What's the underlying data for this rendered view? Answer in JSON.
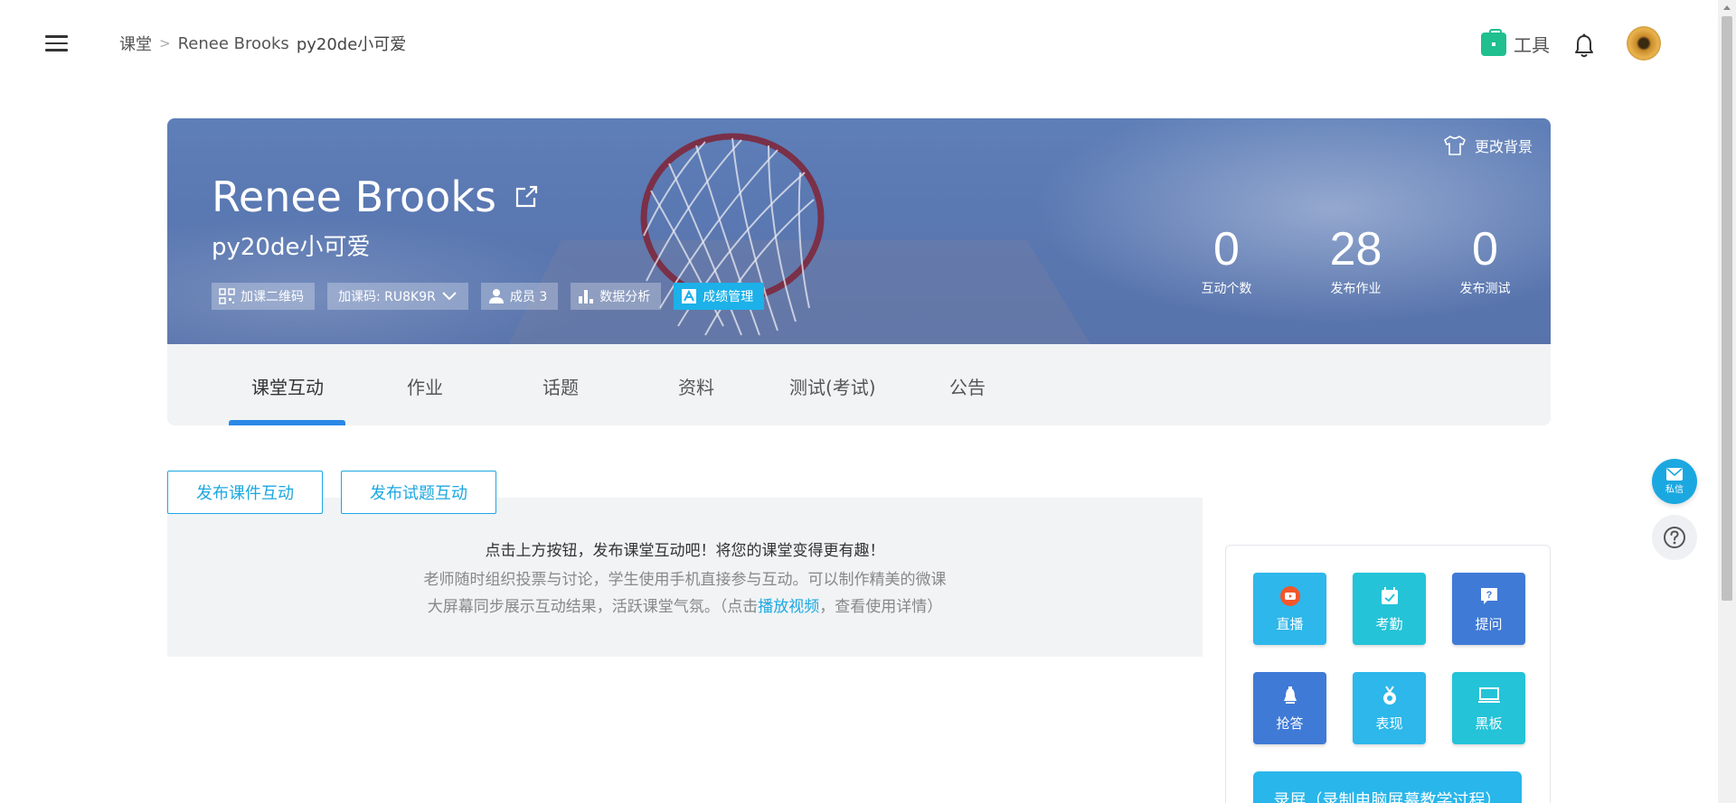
{
  "header": {
    "breadcrumb": [
      "课堂",
      "Renee Brooks",
      "py20de小可爱"
    ],
    "breadcrumb_sep": ">",
    "tools_label": "工具",
    "menu_icon": "hamburger-icon",
    "bell_icon": "bell-icon",
    "tools_icon": "toolbox-icon"
  },
  "banner": {
    "change_bg_label": "更改背景",
    "course_name": "Renee Brooks",
    "class_name": "py20de小可爱",
    "chips": {
      "qr": "加课二维码",
      "code": "加课码: RU8K9R",
      "members": "成员 3",
      "analysis": "数据分析",
      "grades": "成绩管理"
    },
    "stats": [
      {
        "value": "0",
        "label": "互动个数"
      },
      {
        "value": "28",
        "label": "发布作业"
      },
      {
        "value": "0",
        "label": "发布测试"
      }
    ]
  },
  "tabs": [
    "课堂互动",
    "作业",
    "话题",
    "资料",
    "测试(考试)",
    "公告"
  ],
  "actions": {
    "publish_courseware": "发布课件互动",
    "publish_question": "发布试题互动"
  },
  "info": {
    "title": "点击上方按钮，发布课堂互动吧！将您的课堂变得更有趣！",
    "line1": "老师随时组织投票与讨论，学生使用手机直接参与互动。可以制作精美的微课",
    "line2_prefix": "大屏幕同步展示互动结果，活跃课堂气氛。（点击",
    "line2_link": "播放视频",
    "line2_suffix": "，查看使用详情）"
  },
  "panel": {
    "tiles": [
      {
        "label": "直播",
        "icon": "live-icon",
        "color": "#2db7ea"
      },
      {
        "label": "考勤",
        "icon": "attendance-icon",
        "color": "#24c3d8"
      },
      {
        "label": "提问",
        "icon": "question-icon",
        "color": "#3f7ad6"
      },
      {
        "label": "抢答",
        "icon": "buzzer-icon",
        "color": "#3f7ad6"
      },
      {
        "label": "表现",
        "icon": "medal-icon",
        "color": "#2db7ea"
      },
      {
        "label": "黑板",
        "icon": "blackboard-icon",
        "color": "#24c3d8"
      }
    ],
    "record_label": "录屏（录制电脑屏幕教学过程）"
  },
  "floating": {
    "message_label": "私信"
  },
  "colors": {
    "accent": "#1ba8e0",
    "tab_underline": "#2a88e6",
    "grades_chip": "#1cb1e9"
  }
}
